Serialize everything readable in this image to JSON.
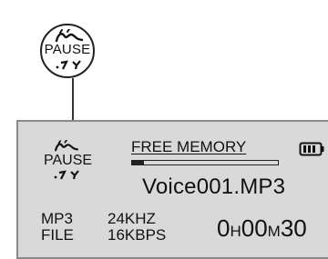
{
  "callout": {
    "label": "PAUSE"
  },
  "lcd": {
    "status_label": "PAUSE",
    "memory_label": "FREE MEMORY",
    "memory_fraction": 0.08,
    "battery_icon": "battery-icon",
    "filename": "Voice001.MP3",
    "format": {
      "line1": "MP3",
      "line2": "FILE"
    },
    "rate": {
      "line1": "24KHZ",
      "line2": "16KBPS"
    },
    "time": {
      "hours": "0",
      "h_unit": "H",
      "minutes": "00",
      "m_unit": "M",
      "seconds": "30"
    }
  },
  "colors": {
    "lcd_background": "#d9d9d9",
    "ink": "#111111"
  }
}
